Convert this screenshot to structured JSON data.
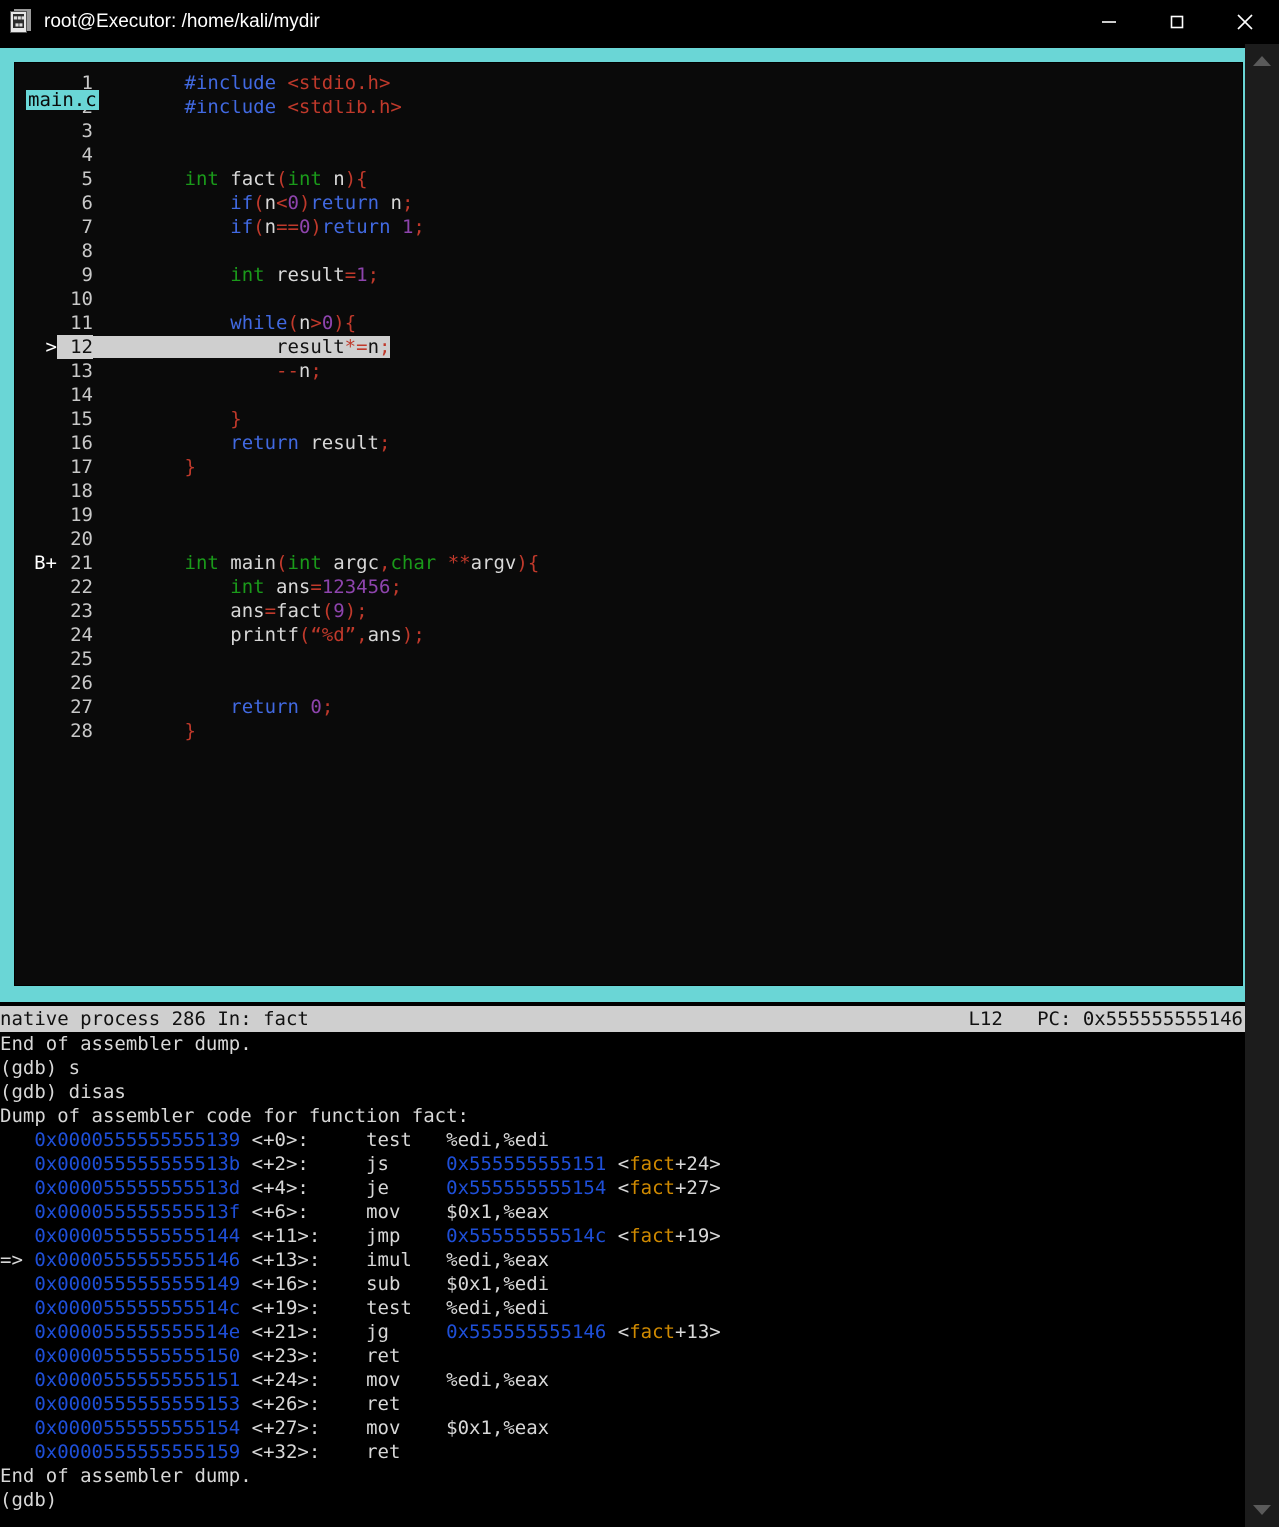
{
  "window": {
    "title": "root@Executor: /home/kali/mydir",
    "icon": "terminal-document-icon",
    "controls": {
      "minimize": "minimize-icon",
      "maximize": "maximize-icon",
      "close": "close-icon"
    }
  },
  "source_panel": {
    "filename": "main.c",
    "border_color": "#6ad6d6",
    "background": "#0a0a0a",
    "lines": [
      {
        "mark": "",
        "num": "1",
        "tokens": [
          {
            "t": "        ",
            "c": "id"
          },
          {
            "t": "#include ",
            "c": "pp"
          },
          {
            "t": "<stdio.h>",
            "c": "str"
          }
        ]
      },
      {
        "mark": "",
        "num": "2",
        "tokens": [
          {
            "t": "        ",
            "c": "id"
          },
          {
            "t": "#include ",
            "c": "pp"
          },
          {
            "t": "<stdlib.h>",
            "c": "str"
          }
        ]
      },
      {
        "mark": "",
        "num": "3",
        "tokens": []
      },
      {
        "mark": "",
        "num": "4",
        "tokens": []
      },
      {
        "mark": "",
        "num": "5",
        "tokens": [
          {
            "t": "        ",
            "c": "id"
          },
          {
            "t": "int",
            "c": "typ"
          },
          {
            "t": " fact",
            "c": "id"
          },
          {
            "t": "(",
            "c": "pun"
          },
          {
            "t": "int",
            "c": "typ"
          },
          {
            "t": " n",
            "c": "id"
          },
          {
            "t": ")",
            "c": "pun"
          },
          {
            "t": "{",
            "c": "pun"
          }
        ]
      },
      {
        "mark": "",
        "num": "6",
        "tokens": [
          {
            "t": "            ",
            "c": "id"
          },
          {
            "t": "if",
            "c": "kw"
          },
          {
            "t": "(",
            "c": "pun"
          },
          {
            "t": "n",
            "c": "id"
          },
          {
            "t": "<",
            "c": "op"
          },
          {
            "t": "0",
            "c": "num"
          },
          {
            "t": ")",
            "c": "pun"
          },
          {
            "t": "return",
            "c": "kw"
          },
          {
            "t": " n",
            "c": "id"
          },
          {
            "t": ";",
            "c": "pun"
          }
        ]
      },
      {
        "mark": "",
        "num": "7",
        "tokens": [
          {
            "t": "            ",
            "c": "id"
          },
          {
            "t": "if",
            "c": "kw"
          },
          {
            "t": "(",
            "c": "pun"
          },
          {
            "t": "n",
            "c": "id"
          },
          {
            "t": "==",
            "c": "op"
          },
          {
            "t": "0",
            "c": "num"
          },
          {
            "t": ")",
            "c": "pun"
          },
          {
            "t": "return",
            "c": "kw"
          },
          {
            "t": " ",
            "c": "id"
          },
          {
            "t": "1",
            "c": "num"
          },
          {
            "t": ";",
            "c": "pun"
          }
        ]
      },
      {
        "mark": "",
        "num": "8",
        "tokens": []
      },
      {
        "mark": "",
        "num": "9",
        "tokens": [
          {
            "t": "            ",
            "c": "id"
          },
          {
            "t": "int",
            "c": "typ"
          },
          {
            "t": " result",
            "c": "id"
          },
          {
            "t": "=",
            "c": "op"
          },
          {
            "t": "1",
            "c": "num"
          },
          {
            "t": ";",
            "c": "pun"
          }
        ]
      },
      {
        "mark": "",
        "num": "10",
        "tokens": []
      },
      {
        "mark": "",
        "num": "11",
        "tokens": [
          {
            "t": "            ",
            "c": "id"
          },
          {
            "t": "while",
            "c": "kw"
          },
          {
            "t": "(",
            "c": "pun"
          },
          {
            "t": "n",
            "c": "id"
          },
          {
            "t": ">",
            "c": "op"
          },
          {
            "t": "0",
            "c": "num"
          },
          {
            "t": ")",
            "c": "pun"
          },
          {
            "t": "{",
            "c": "pun"
          }
        ]
      },
      {
        "mark": ">",
        "num": "12",
        "highlight": true,
        "tokens": [
          {
            "t": "                result",
            "c": "id"
          },
          {
            "t": "*=",
            "c": "op"
          },
          {
            "t": "n",
            "c": "id"
          },
          {
            "t": ";",
            "c": "pun"
          }
        ]
      },
      {
        "mark": "",
        "num": "13",
        "tokens": [
          {
            "t": "                ",
            "c": "id"
          },
          {
            "t": "--",
            "c": "op"
          },
          {
            "t": "n",
            "c": "id"
          },
          {
            "t": ";",
            "c": "pun"
          }
        ]
      },
      {
        "mark": "",
        "num": "14",
        "tokens": []
      },
      {
        "mark": "",
        "num": "15",
        "tokens": [
          {
            "t": "            ",
            "c": "id"
          },
          {
            "t": "}",
            "c": "pun"
          }
        ]
      },
      {
        "mark": "",
        "num": "16",
        "tokens": [
          {
            "t": "            ",
            "c": "id"
          },
          {
            "t": "return",
            "c": "kw"
          },
          {
            "t": " result",
            "c": "id"
          },
          {
            "t": ";",
            "c": "pun"
          }
        ]
      },
      {
        "mark": "",
        "num": "17",
        "tokens": [
          {
            "t": "        ",
            "c": "id"
          },
          {
            "t": "}",
            "c": "pun"
          }
        ]
      },
      {
        "mark": "",
        "num": "18",
        "tokens": []
      },
      {
        "mark": "",
        "num": "19",
        "tokens": []
      },
      {
        "mark": "",
        "num": "20",
        "tokens": []
      },
      {
        "mark": "B+",
        "num": "21",
        "tokens": [
          {
            "t": "        ",
            "c": "id"
          },
          {
            "t": "int",
            "c": "typ"
          },
          {
            "t": " main",
            "c": "id"
          },
          {
            "t": "(",
            "c": "pun"
          },
          {
            "t": "int",
            "c": "typ"
          },
          {
            "t": " argc",
            "c": "id"
          },
          {
            "t": ",",
            "c": "pun"
          },
          {
            "t": "char",
            "c": "typ"
          },
          {
            "t": " ",
            "c": "id"
          },
          {
            "t": "**",
            "c": "op"
          },
          {
            "t": "argv",
            "c": "id"
          },
          {
            "t": ")",
            "c": "pun"
          },
          {
            "t": "{",
            "c": "pun"
          }
        ]
      },
      {
        "mark": "",
        "num": "22",
        "tokens": [
          {
            "t": "            ",
            "c": "id"
          },
          {
            "t": "int",
            "c": "typ"
          },
          {
            "t": " ans",
            "c": "id"
          },
          {
            "t": "=",
            "c": "op"
          },
          {
            "t": "123456",
            "c": "num"
          },
          {
            "t": ";",
            "c": "pun"
          }
        ]
      },
      {
        "mark": "",
        "num": "23",
        "tokens": [
          {
            "t": "            ans",
            "c": "id"
          },
          {
            "t": "=",
            "c": "op"
          },
          {
            "t": "fact",
            "c": "id"
          },
          {
            "t": "(",
            "c": "pun"
          },
          {
            "t": "9",
            "c": "num"
          },
          {
            "t": ")",
            "c": "pun"
          },
          {
            "t": ";",
            "c": "pun"
          }
        ]
      },
      {
        "mark": "",
        "num": "24",
        "tokens": [
          {
            "t": "            printf",
            "c": "id"
          },
          {
            "t": "(",
            "c": "pun"
          },
          {
            "t": "“%d”",
            "c": "str"
          },
          {
            "t": ",",
            "c": "pun"
          },
          {
            "t": "ans",
            "c": "id"
          },
          {
            "t": ")",
            "c": "pun"
          },
          {
            "t": ";",
            "c": "pun"
          }
        ]
      },
      {
        "mark": "",
        "num": "25",
        "tokens": []
      },
      {
        "mark": "",
        "num": "26",
        "tokens": []
      },
      {
        "mark": "",
        "num": "27",
        "tokens": [
          {
            "t": "            ",
            "c": "id"
          },
          {
            "t": "return",
            "c": "kw"
          },
          {
            "t": " ",
            "c": "id"
          },
          {
            "t": "0",
            "c": "num"
          },
          {
            "t": ";",
            "c": "pun"
          }
        ]
      },
      {
        "mark": "",
        "num": "28",
        "tokens": [
          {
            "t": "        ",
            "c": "id"
          },
          {
            "t": "}",
            "c": "pun"
          }
        ]
      }
    ]
  },
  "statusbar": {
    "left": "native process 286 In: fact",
    "right": "L12   PC: 0x555555555146"
  },
  "console": {
    "lines": [
      {
        "tokens": [
          {
            "t": "End of assembler dump.",
            "c": "plain"
          }
        ]
      },
      {
        "tokens": [
          {
            "t": "(gdb) s",
            "c": "plain"
          }
        ]
      },
      {
        "tokens": [
          {
            "t": "(gdb) disas",
            "c": "plain"
          }
        ]
      },
      {
        "tokens": [
          {
            "t": "Dump of assembler code for function fact:",
            "c": "plain"
          }
        ]
      },
      {
        "tokens": [
          {
            "t": "   ",
            "c": "plain"
          },
          {
            "t": "0x0000555555555139",
            "c": "addr"
          },
          {
            "t": " <+0>:     test   %edi,%edi",
            "c": "plain"
          }
        ]
      },
      {
        "tokens": [
          {
            "t": "   ",
            "c": "plain"
          },
          {
            "t": "0x000055555555513b",
            "c": "addr"
          },
          {
            "t": " <+2>:     js     ",
            "c": "plain"
          },
          {
            "t": "0x555555555151",
            "c": "addr"
          },
          {
            "t": " <",
            "c": "plain"
          },
          {
            "t": "fact",
            "c": "sym"
          },
          {
            "t": "+24>",
            "c": "plain"
          }
        ]
      },
      {
        "tokens": [
          {
            "t": "   ",
            "c": "plain"
          },
          {
            "t": "0x000055555555513d",
            "c": "addr"
          },
          {
            "t": " <+4>:     je     ",
            "c": "plain"
          },
          {
            "t": "0x555555555154",
            "c": "addr"
          },
          {
            "t": " <",
            "c": "plain"
          },
          {
            "t": "fact",
            "c": "sym"
          },
          {
            "t": "+27>",
            "c": "plain"
          }
        ]
      },
      {
        "tokens": [
          {
            "t": "   ",
            "c": "plain"
          },
          {
            "t": "0x000055555555513f",
            "c": "addr"
          },
          {
            "t": " <+6>:     mov    $0x1,%eax",
            "c": "plain"
          }
        ]
      },
      {
        "tokens": [
          {
            "t": "   ",
            "c": "plain"
          },
          {
            "t": "0x0000555555555144",
            "c": "addr"
          },
          {
            "t": " <+11>:    jmp    ",
            "c": "plain"
          },
          {
            "t": "0x55555555514c",
            "c": "addr"
          },
          {
            "t": " <",
            "c": "plain"
          },
          {
            "t": "fact",
            "c": "sym"
          },
          {
            "t": "+19>",
            "c": "plain"
          }
        ]
      },
      {
        "tokens": [
          {
            "t": "=> ",
            "c": "arrow"
          },
          {
            "t": "0x0000555555555146",
            "c": "addr"
          },
          {
            "t": " <+13>:    imul   %edi,%eax",
            "c": "plain"
          }
        ]
      },
      {
        "tokens": [
          {
            "t": "   ",
            "c": "plain"
          },
          {
            "t": "0x0000555555555149",
            "c": "addr"
          },
          {
            "t": " <+16>:    sub    $0x1,%edi",
            "c": "plain"
          }
        ]
      },
      {
        "tokens": [
          {
            "t": "   ",
            "c": "plain"
          },
          {
            "t": "0x000055555555514c",
            "c": "addr"
          },
          {
            "t": " <+19>:    test   %edi,%edi",
            "c": "plain"
          }
        ]
      },
      {
        "tokens": [
          {
            "t": "   ",
            "c": "plain"
          },
          {
            "t": "0x000055555555514e",
            "c": "addr"
          },
          {
            "t": " <+21>:    jg     ",
            "c": "plain"
          },
          {
            "t": "0x555555555146",
            "c": "addr"
          },
          {
            "t": " <",
            "c": "plain"
          },
          {
            "t": "fact",
            "c": "sym"
          },
          {
            "t": "+13>",
            "c": "plain"
          }
        ]
      },
      {
        "tokens": [
          {
            "t": "   ",
            "c": "plain"
          },
          {
            "t": "0x0000555555555150",
            "c": "addr"
          },
          {
            "t": " <+23>:    ret",
            "c": "plain"
          }
        ]
      },
      {
        "tokens": [
          {
            "t": "   ",
            "c": "plain"
          },
          {
            "t": "0x0000555555555151",
            "c": "addr"
          },
          {
            "t": " <+24>:    mov    %edi,%eax",
            "c": "plain"
          }
        ]
      },
      {
        "tokens": [
          {
            "t": "   ",
            "c": "plain"
          },
          {
            "t": "0x0000555555555153",
            "c": "addr"
          },
          {
            "t": " <+26>:    ret",
            "c": "plain"
          }
        ]
      },
      {
        "tokens": [
          {
            "t": "   ",
            "c": "plain"
          },
          {
            "t": "0x0000555555555154",
            "c": "addr"
          },
          {
            "t": " <+27>:    mov    $0x1,%eax",
            "c": "plain"
          }
        ]
      },
      {
        "tokens": [
          {
            "t": "   ",
            "c": "plain"
          },
          {
            "t": "0x0000555555555159",
            "c": "addr"
          },
          {
            "t": " <+32>:    ret",
            "c": "plain"
          }
        ]
      },
      {
        "tokens": [
          {
            "t": "End of assembler dump.",
            "c": "plain"
          }
        ]
      },
      {
        "tokens": [
          {
            "t": "(gdb)",
            "c": "plain"
          }
        ]
      }
    ]
  },
  "scrollbar": {
    "up_arrow": "scroll-up-arrow-icon",
    "down_arrow": "scroll-down-arrow-icon"
  }
}
